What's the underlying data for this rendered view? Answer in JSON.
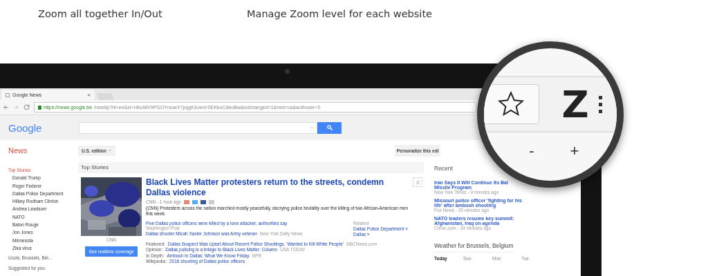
{
  "features": [
    "Zoom all together In/Out",
    "Manage Zoom level for each website"
  ],
  "browser": {
    "tab_title": "Google News",
    "tab_close": "×",
    "url_host": "https://news.google.be",
    "url_path": "/nwshp?hl=en&ei=HbuWV9PGOYnuarX?pqgK&ved=0EKkuCAkoBw&edchanged=1&ned=us&authuser=0"
  },
  "header": {
    "logo": "Google",
    "section": "News",
    "edition": "U.S. edition",
    "personalize": "Personalize this edi"
  },
  "sidebar": {
    "heading": "Top Stories",
    "items": [
      "Donald Trump",
      "Roger Federer",
      "Dallas Police Department",
      "Hillary Rodham Clinton",
      "Andrea Leadsom",
      "NATO",
      "Baton Rouge",
      "Jon Jones",
      "Minnesota",
      "Zika virus"
    ],
    "location": "Uccle, Brussels, Bel...",
    "suggested": "Suggested for you"
  },
  "top_stories": {
    "heading": "Top Stories",
    "image_caption": "CNN",
    "coverage_button": "See realtime coverage",
    "headline": "Black Lives Matter protesters return to the streets, condemn Dallas violence",
    "source": "CNN - 1 hour ago",
    "snippet": "(CNN) Protesters across the nation marched mostly peacefully, decrying police brutality over the killing of two African-American men this week.",
    "links": [
      {
        "text": "Five Dallas police officers were killed by a lone attacker, authorities say",
        "source": "Washington Post"
      },
      {
        "text": "Dallas shooter Micah Xavier Johnson was Army veteran",
        "source": "New York Daily News"
      }
    ],
    "related": {
      "label": "Related",
      "links": [
        "Dallas Police Department »",
        "Dallas »"
      ]
    },
    "more": [
      {
        "label": "Featured:",
        "text": "Dallas Suspect Was Upset About Recent Police Shootings, 'Wanted to Kill White People'",
        "source": "NBCNews.com"
      },
      {
        "label": "Opinion:",
        "text": "Dallas policing is a bridge to Black Lives Matter: Column",
        "source": "USA TODAY"
      },
      {
        "label": "In Depth:",
        "text": "Ambush In Dallas: What We Know Friday",
        "source": "NPR"
      },
      {
        "label": "Wikipedia:",
        "text": "2016 shooting of Dallas police officers"
      }
    ]
  },
  "recent": {
    "heading": "Recent",
    "items": [
      {
        "title": "Iran Says It Will Continue Its Bal",
        "title2": "Missile Program",
        "source": "New York Times - 9 minutes ago"
      },
      {
        "title": "Missouri police officer 'fighting for his",
        "title2": "life' after ambush shooting",
        "source": "Fox News - 20 minutes ago"
      },
      {
        "title": "NATO leaders resume key summit:",
        "title2": "Afghanistan, Iraq on agenda",
        "source": "Chron.com - 34 minutes ago"
      }
    ]
  },
  "weather": {
    "heading": "Weather for Brussels, Belgium",
    "days": [
      "Today",
      "Sun",
      "Mon",
      "Tue"
    ]
  },
  "magnifier": {
    "zoom_letter": "Z",
    "minus": "-",
    "plus": "+"
  }
}
